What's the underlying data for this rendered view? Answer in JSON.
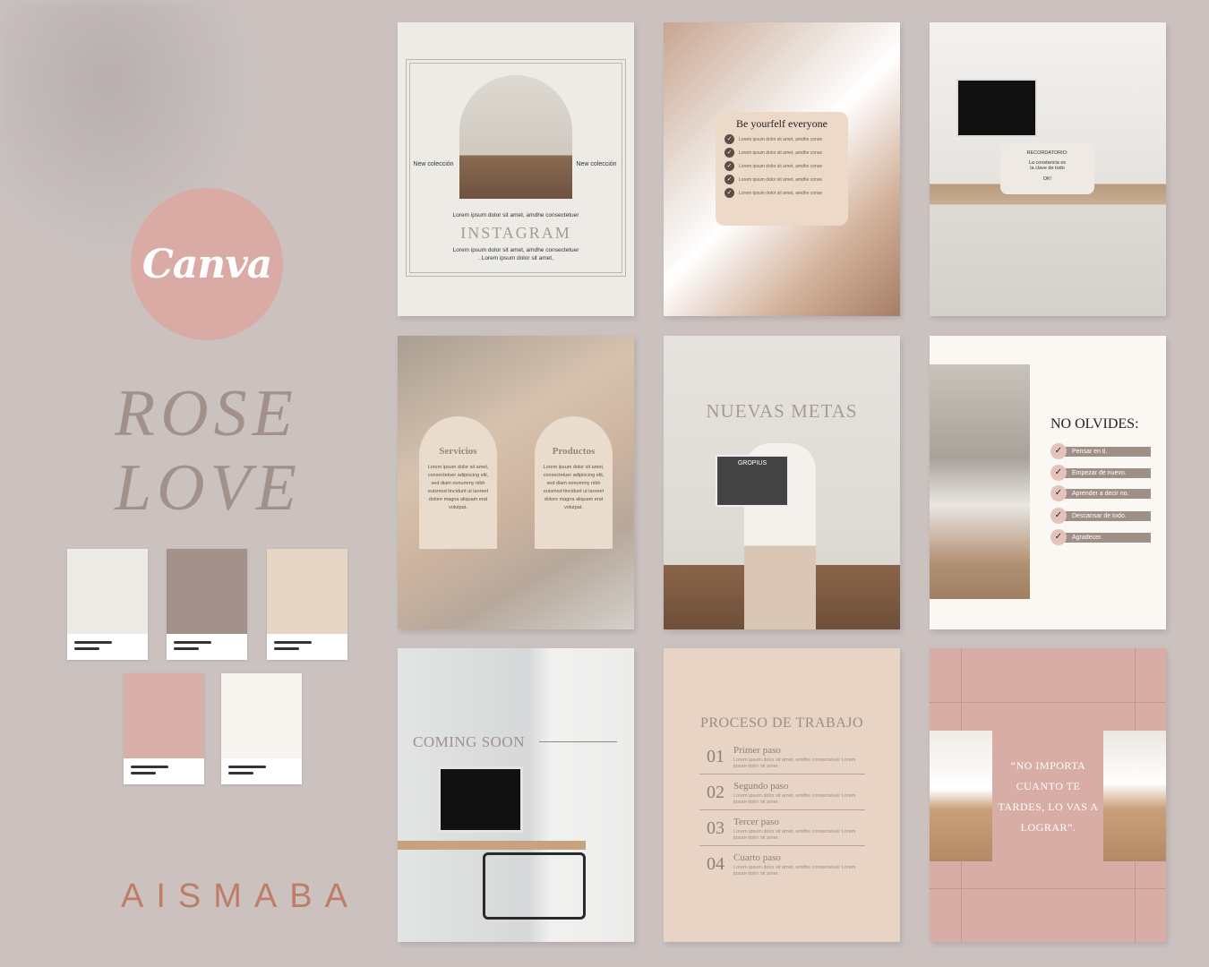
{
  "brand": {
    "canva": "Canva",
    "title_line1": "ROSE",
    "title_line2": "LOVE",
    "studio": "AISMABA"
  },
  "palette": [
    "#ecebe6",
    "#a2918a",
    "#e7d6c6",
    "#d9b0a9",
    "#f7f3ef"
  ],
  "tile1": {
    "left_label": "New colección",
    "right_label": "New colección",
    "line1": "Lorem ipsum dolor sit amet, amdhe consectetuer",
    "title": "INSTAGRAM",
    "line2": "Lorem ipsum dolor sit amet, amdhe consectetuer",
    "line3": ". Lorem ipsum dolor sit amet,"
  },
  "tile2": {
    "card_title": "Be yourfelf everyone",
    "items": [
      "Lorem ipsum dolor sit amet, amdhe conse",
      "Lorem ipsum dolor sit amet, amdhe conse",
      "Lorem ipsum dolor sit amet, amdhe conse",
      "Lorem ipsum dolor sit amet, amdhe conse",
      "Lorem ipsum dolor sit amet, amdhe conse"
    ]
  },
  "tile3": {
    "label": "RECORDATORIO:",
    "text1": "La constancia es",
    "text2": "la clave de todo",
    "button": "OK!"
  },
  "tile4": {
    "card1_title": "Servicios",
    "card2_title": "Productos",
    "card_body": "Lorem ipsum dolor sit amet, consectetuer adipiscing elit, sed diam nonummy nibh euismod tincidunt ut laoreet dolore magna aliquam erat volutpat."
  },
  "tile5": {
    "title": "NUEVAS METAS",
    "magazine": "GROPIUS"
  },
  "tile6": {
    "title": "NO OLVIDES:",
    "items": [
      "Pensar en ti.",
      "Empezar de nuevo.",
      "Aprender a decir no.",
      "Descansar de todo.",
      "Agradecer."
    ]
  },
  "tile7": {
    "title": "COMING SOON"
  },
  "tile8": {
    "title": "PROCESO DE TRABAJO",
    "steps": [
      {
        "num": "01",
        "title": "Primer paso"
      },
      {
        "num": "02",
        "title": "Segundo paso"
      },
      {
        "num": "03",
        "title": "Tercer paso"
      },
      {
        "num": "04",
        "title": "Cuarto paso"
      }
    ],
    "step_body": "Lorem ipsum dolor sit amet, amdhe consectetuer Lorem ipsum dolor sit amet."
  },
  "tile9": {
    "quote": "“NO IMPORTA CUANTO TE TARDES, LO VAS A LOGRAR”."
  }
}
